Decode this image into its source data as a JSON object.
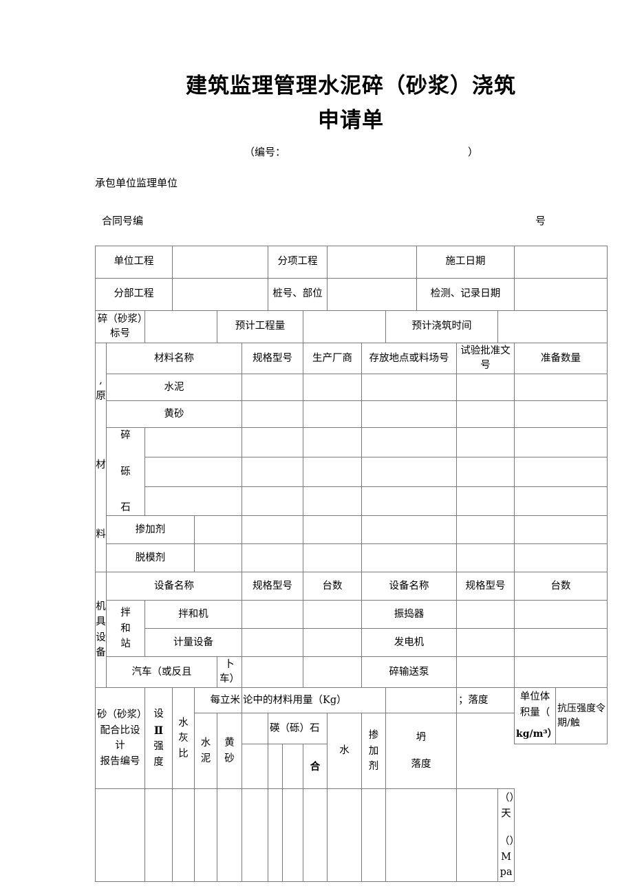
{
  "document": {
    "title_line1": "建筑监理管理水泥碎（砂浆）浇筑",
    "title_line2": "申请单",
    "serial_label": "（编号：",
    "serial_close": "）",
    "units_label": "承包单位监理单位",
    "contract_label": "合同号编",
    "contract_suffix": "号"
  },
  "table": {
    "row1": {
      "label1": "单位工程",
      "value1": "",
      "label2": "分项工程",
      "value2": "",
      "label3": "施工日期",
      "value3": ""
    },
    "row2": {
      "label1": "分部工程",
      "value1": "",
      "label2": "桩号、部位",
      "value2": "",
      "label3": "检测、记录日期",
      "value3": ""
    },
    "row3": {
      "label1": "碎（砂浆）标号",
      "value1": "",
      "label2": "预计工程量",
      "value2": "",
      "label3": "预计浇筑时间",
      "value3": ""
    },
    "materials": {
      "section_label_lines": [
        ",原",
        "材",
        "料"
      ],
      "headers": [
        "材料名称",
        "规格型号",
        "生产厂商",
        "存放地点或料场号",
        "试验批准文号",
        "准备数量"
      ],
      "rows": [
        {
          "name": "水泥"
        },
        {
          "name": "黄砂"
        }
      ],
      "gravel_label_lines": [
        "碎",
        "砾",
        "石"
      ],
      "gravel_rows": 3,
      "extra_rows": [
        {
          "name": "掺加剂"
        },
        {
          "name": "脱模剂"
        }
      ]
    },
    "equipment": {
      "section_label_lines": [
        "机具",
        "设备"
      ],
      "headers": [
        "设备名称",
        "规格型号",
        "台数",
        "设备名称",
        "规格型号",
        "台数"
      ],
      "station_label_lines": [
        "拌",
        "和",
        "站"
      ],
      "rows": [
        {
          "left_name": "拌和机",
          "right_name": "振捣器"
        },
        {
          "left_name": "计量设备",
          "right_name": "发电机"
        }
      ],
      "truck_row": {
        "left_name_a": "汽车（或反且",
        "left_name_b": "卜车）",
        "right_name": "碎输送泵"
      }
    },
    "mix": {
      "section_label_lines": [
        "砂（砂浆）",
        "配合比设计",
        "报告编号"
      ],
      "design_strength_lines": [
        "设",
        "Ⅱ",
        "强",
        "度"
      ],
      "water_cement_lines": [
        "水",
        "灰",
        "比"
      ],
      "per_cubic_header": "每立米",
      "material_amount_header": "论中的材料用量（Kg）",
      "cement_lines": [
        "水",
        "泥"
      ],
      "sand_lines": [
        "黄",
        "砂"
      ],
      "gravel_group_header": "碤（砾）石",
      "gravel_total_label": "合",
      "water_label": "水",
      "admixture_lines": [
        "掺",
        "加",
        "剂"
      ],
      "slump_top_header": "；落度",
      "slump_lines": [
        "坍",
        "落度"
      ],
      "unit_volume_line1": "单位体积量（",
      "unit_volume_line2": "kg/m³）",
      "compressive_header": "抗压强度令期/触",
      "result_days": "（）天",
      "result_mpa": "（）Mpa"
    }
  }
}
